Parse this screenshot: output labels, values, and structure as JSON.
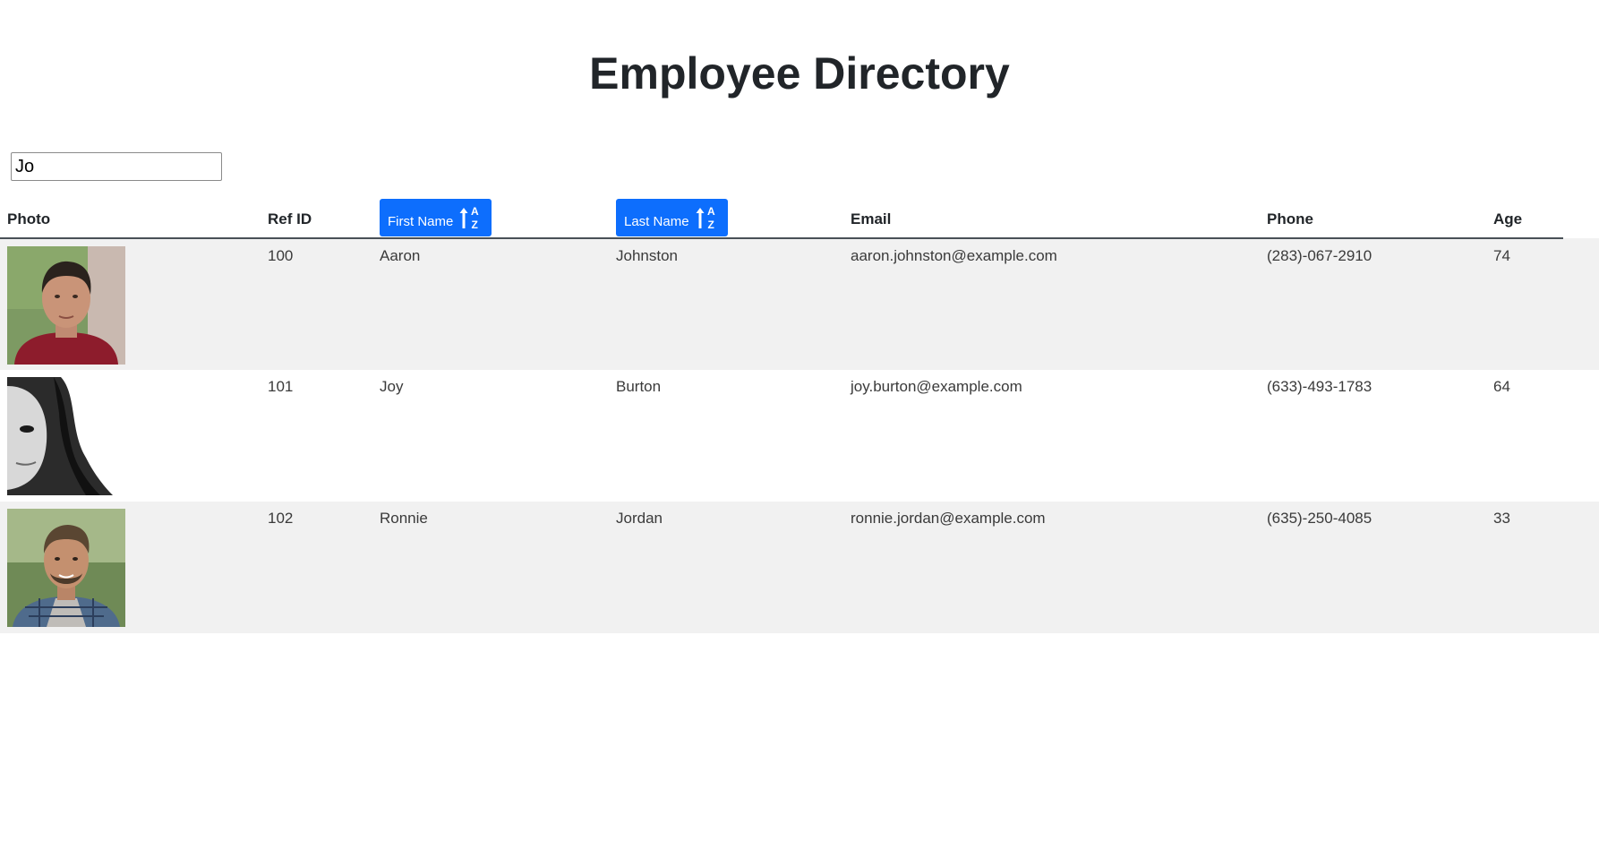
{
  "page": {
    "title": "Employee Directory"
  },
  "search": {
    "value": "Jo"
  },
  "table": {
    "headers": {
      "photo": "Photo",
      "ref_id": "Ref ID",
      "first_name": "First Name",
      "last_name": "Last Name",
      "email": "Email",
      "phone": "Phone",
      "age": "Age"
    },
    "sort_icon": "sort-alpha-up-icon",
    "rows": [
      {
        "ref_id": "100",
        "first_name": "Aaron",
        "last_name": "Johnston",
        "email": "aaron.johnston@example.com",
        "phone": "(283)-067-2910",
        "age": "74",
        "photo": "man-portrait-red-shirt"
      },
      {
        "ref_id": "101",
        "first_name": "Joy",
        "last_name": "Burton",
        "email": "joy.burton@example.com",
        "phone": "(633)-493-1783",
        "age": "64",
        "photo": "woman-portrait-black-and-white"
      },
      {
        "ref_id": "102",
        "first_name": "Ronnie",
        "last_name": "Jordan",
        "email": "ronnie.jordan@example.com",
        "phone": "(635)-250-4085",
        "age": "33",
        "photo": "man-portrait-plaid-shirt"
      }
    ]
  },
  "colors": {
    "accent": "#0d6efd",
    "row_stripe": "#f1f1f1",
    "text": "#212529"
  }
}
